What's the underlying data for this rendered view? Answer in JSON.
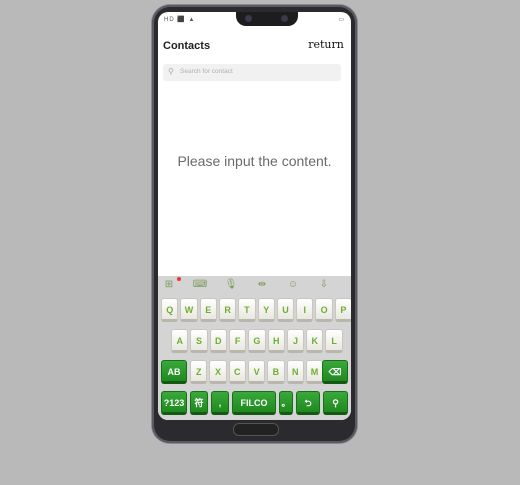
{
  "status": {
    "left": "HD ⬛ ▲",
    "right": "▭"
  },
  "header": {
    "title": "Contacts",
    "return_label": "return"
  },
  "search": {
    "placeholder": "Search for contact",
    "icon": "search-icon"
  },
  "content": {
    "placeholder": "Please input the content."
  },
  "keyboard": {
    "toolbar": [
      {
        "name": "apps-icon",
        "glyph": "⊞"
      },
      {
        "name": "keyboard-icon",
        "glyph": "⌨"
      },
      {
        "name": "mic-icon",
        "glyph": "🎙"
      },
      {
        "name": "cursor-move-icon",
        "glyph": "⇹"
      },
      {
        "name": "emoji-icon",
        "glyph": "☺"
      },
      {
        "name": "hide-keyboard-icon",
        "glyph": "⇩"
      }
    ],
    "row1": [
      "Q",
      "W",
      "E",
      "R",
      "T",
      "Y",
      "U",
      "I",
      "O",
      "P"
    ],
    "row2": [
      "A",
      "S",
      "D",
      "F",
      "G",
      "H",
      "J",
      "K",
      "L"
    ],
    "row3": [
      "Z",
      "X",
      "C",
      "V",
      "B",
      "N",
      "M"
    ],
    "shift_label": "AB",
    "backspace_label": "⌫",
    "num_label": "?123",
    "lang_label": "符",
    "comma_label": ",",
    "space_label": "FILCO",
    "period_label": "。",
    "enter_label": "⮌",
    "search_label": "⚲",
    "accent_color": "#2a9a2a"
  }
}
